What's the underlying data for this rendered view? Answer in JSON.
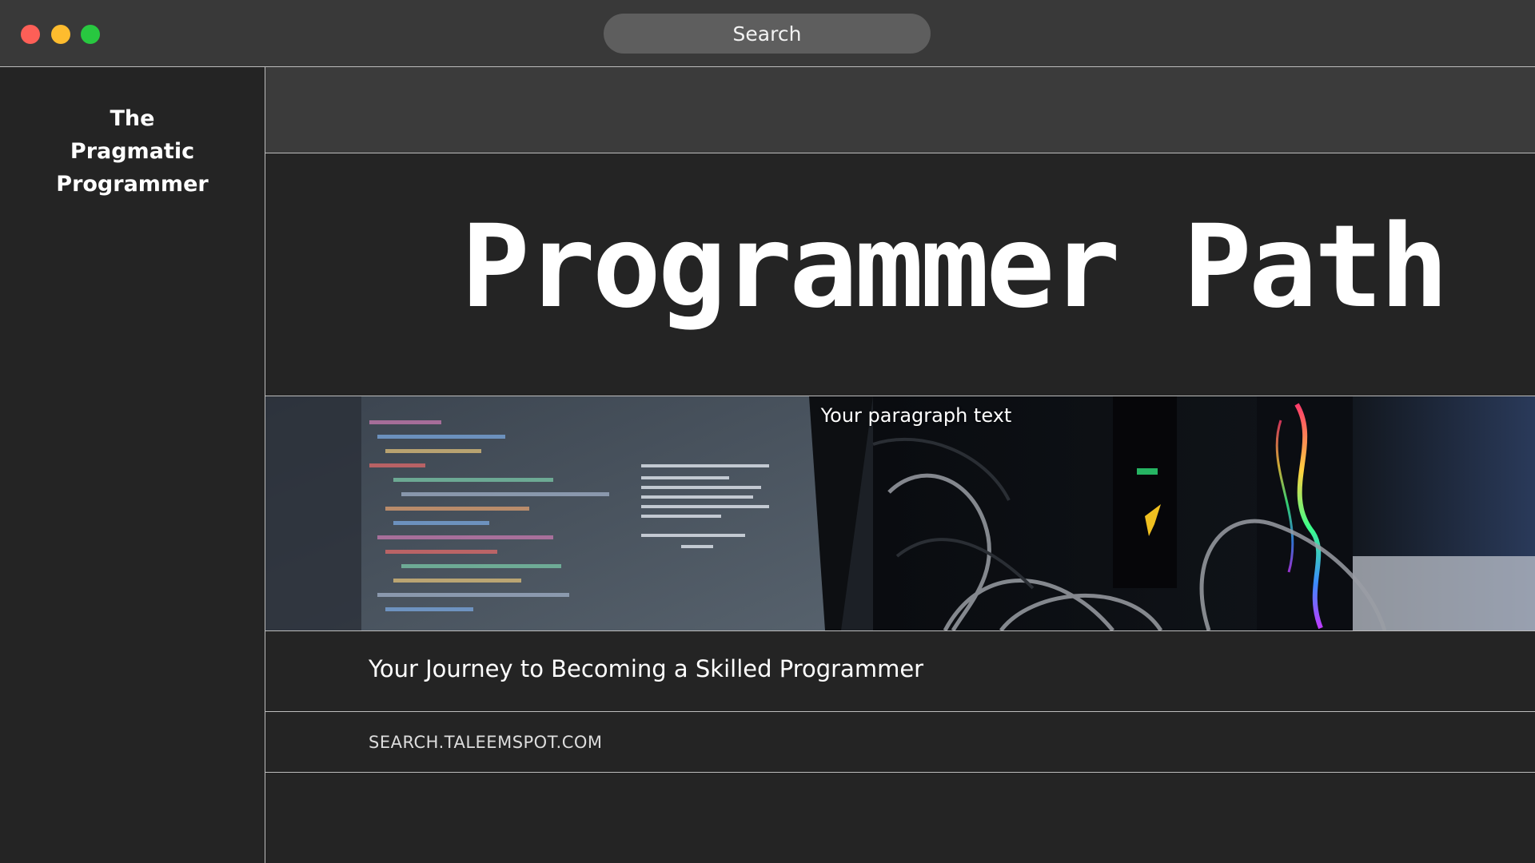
{
  "window": {
    "controls": {
      "close_color": "#fe5f57",
      "minimize_color": "#febc2e",
      "maximize_color": "#28c840"
    },
    "search": {
      "label": "Search"
    }
  },
  "sidebar": {
    "brand_lines": [
      "The",
      "Pragmatic",
      "Programmer"
    ]
  },
  "main": {
    "hero_title": "Programmer Path",
    "banner": {
      "caption": "Your paragraph text",
      "image": "laptop-code-editor-and-pc-cables-photo"
    },
    "subtitle": "Your Journey to Becoming a Skilled Programmer",
    "url": "SEARCH.TALEEMSPOT.COM"
  },
  "colors": {
    "background": "#242424",
    "titlebar": "#393939",
    "topstrip": "#3b3b3b",
    "search_pill": "#5e5e5e",
    "divider": "#bdbdbd"
  }
}
